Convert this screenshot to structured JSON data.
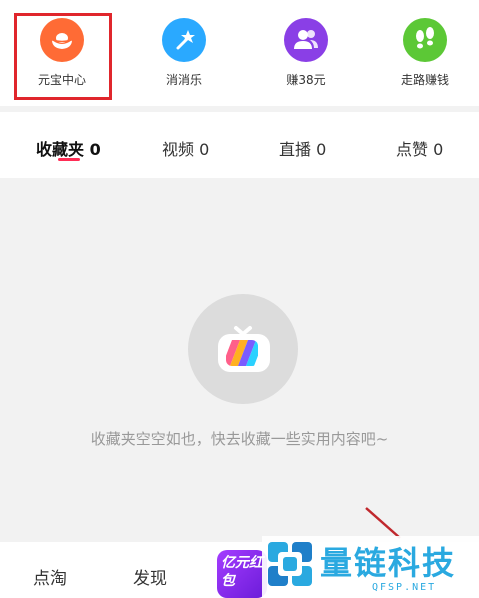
{
  "shortcuts": [
    {
      "label": "元宝中心",
      "icon": "yuanbao-icon",
      "color": "#ff6b35"
    },
    {
      "label": "消消乐",
      "icon": "magic-wand-icon",
      "color": "#2aa9ff"
    },
    {
      "label": "赚38元",
      "icon": "user-group-icon",
      "color": "#8a3fe6"
    },
    {
      "label": "走路赚钱",
      "icon": "footprints-icon",
      "color": "#5cc836"
    }
  ],
  "tabs": [
    {
      "label": "收藏夹 0"
    },
    {
      "label": "视频 0"
    },
    {
      "label": "直播 0"
    },
    {
      "label": "点赞 0"
    }
  ],
  "empty": {
    "message": "收藏夹空空如也，快去收藏一些实用内容吧~",
    "icon": "tv-icon"
  },
  "bottom_nav": {
    "item1": "点淘",
    "item2": "发现",
    "promo": "亿元红包"
  },
  "watermark": {
    "text": "量链科技",
    "sub": "QFSP.NET"
  },
  "colors": {
    "highlight": "#e0262c",
    "tab_underline": "#ff2d55",
    "watermark": "#2aa9e0"
  }
}
